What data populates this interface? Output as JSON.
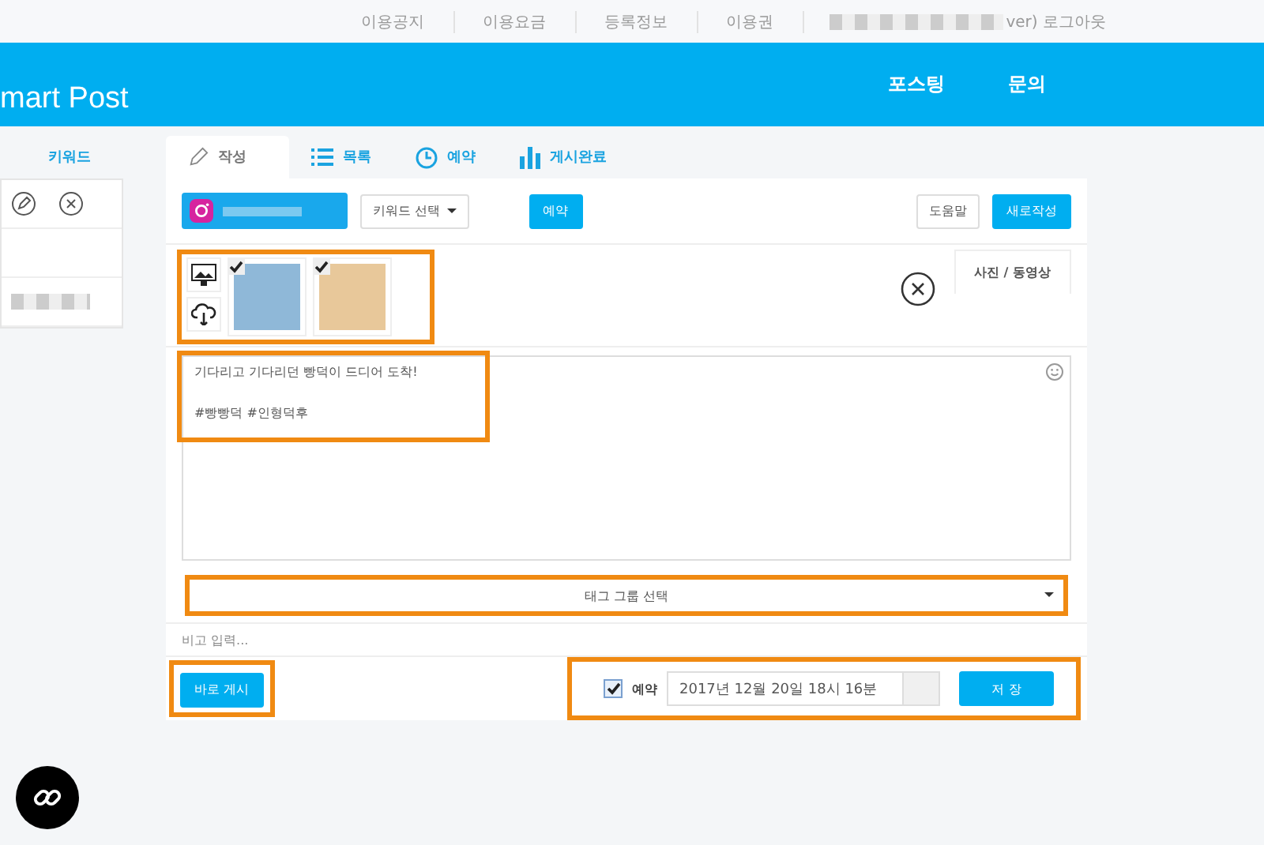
{
  "top_links": [
    "이용공지",
    "이용요금",
    "등록정보",
    "이용권"
  ],
  "logout": "ver) 로그아웃",
  "brand": "mart Post",
  "nav": [
    "포스팅",
    "문의"
  ],
  "side_tab": "키워드",
  "tabs": [
    {
      "label": "작성",
      "selected": true
    },
    {
      "label": "목록",
      "selected": false
    },
    {
      "label": "예약",
      "selected": false
    },
    {
      "label": "게시완료",
      "selected": false
    }
  ],
  "keyword_select": "키워드 선택",
  "reserve_button": "예약",
  "help_button": "도움말",
  "new_button": "새로작성",
  "media_tab": "사진 / 동영상",
  "images": [
    {
      "checked": true,
      "color": "#8fb8d8"
    },
    {
      "checked": true,
      "color": "#e8c89a"
    }
  ],
  "post_text": [
    "기다리고 기다리던 빵덕이 드디어 도착!",
    "#빵빵덕 #인형덕후"
  ],
  "tag_group": "태그 그룹 선택",
  "memo_placeholder": "비고 입력...",
  "post_now": "바로 게시",
  "reserve": {
    "label": "예약",
    "checked": true,
    "datetime": "2017년 12월 20일 18시 16분"
  },
  "save": "저 장"
}
